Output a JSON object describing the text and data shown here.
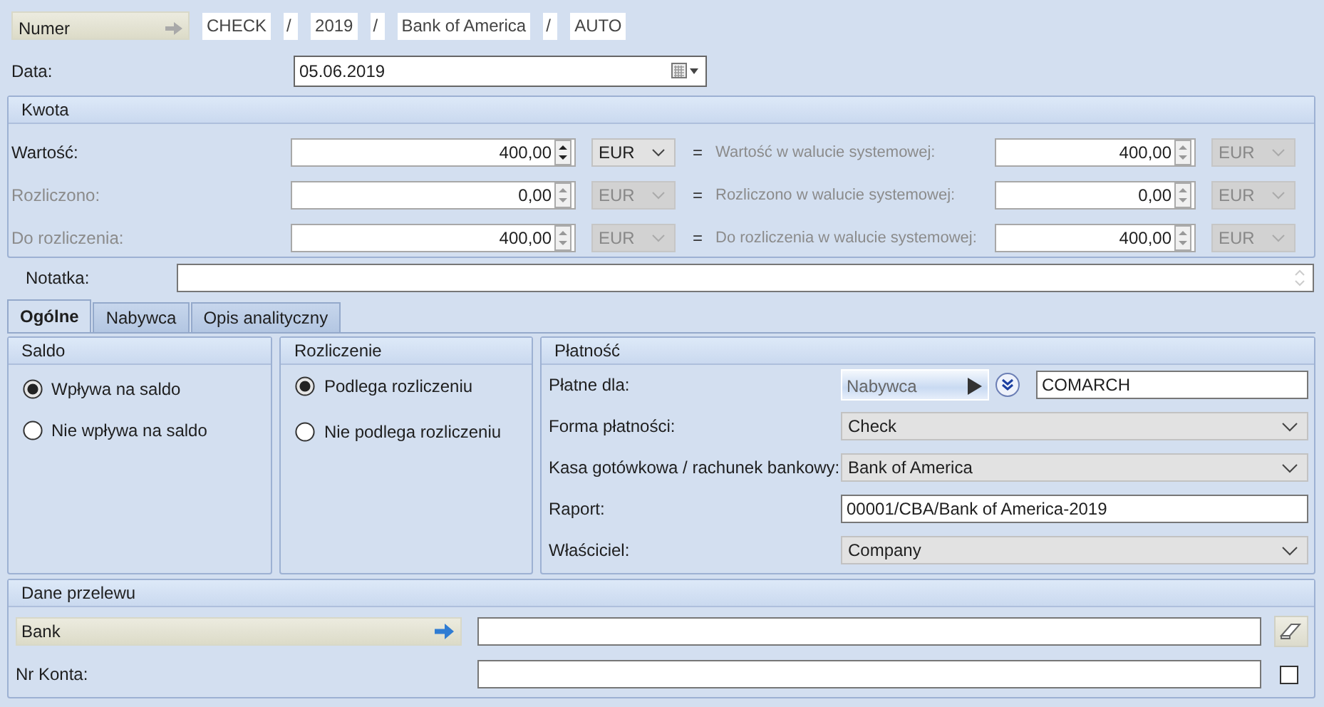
{
  "numer": {
    "label": "Numer",
    "segments": [
      {
        "kind": "field",
        "text": "CHECK"
      },
      {
        "kind": "sep",
        "text": "/"
      },
      {
        "kind": "field",
        "text": "2019"
      },
      {
        "kind": "sep",
        "text": "/"
      },
      {
        "kind": "field",
        "text": "Bank of America"
      },
      {
        "kind": "sep",
        "text": "/"
      },
      {
        "kind": "field",
        "text": "AUTO"
      }
    ]
  },
  "data": {
    "label": "Data:",
    "value": "05.06.2019"
  },
  "kwota": {
    "title": "Kwota",
    "rows": [
      {
        "label": "Wartość:",
        "disabled": false,
        "value": "400,00",
        "currency": "EUR",
        "equals": "=",
        "system_label": "Wartość w walucie systemowej:",
        "system_value": "400,00",
        "system_currency": "EUR",
        "system_disabled": true
      },
      {
        "label": "Rozliczono:",
        "disabled": true,
        "value": "0,00",
        "currency": "EUR",
        "equals": "=",
        "system_label": "Rozliczono w walucie systemowej:",
        "system_value": "0,00",
        "system_currency": "EUR",
        "system_disabled": true
      },
      {
        "label": "Do rozliczenia:",
        "disabled": true,
        "value": "400,00",
        "currency": "EUR",
        "equals": "=",
        "system_label": "Do rozliczenia w walucie systemowej:",
        "system_value": "400,00",
        "system_currency": "EUR",
        "system_disabled": true
      }
    ]
  },
  "notatka": {
    "label": "Notatka:"
  },
  "tabs": [
    {
      "label": "Ogólne",
      "selected": true
    },
    {
      "label": "Nabywca",
      "selected": false
    },
    {
      "label": "Opis analityczny",
      "selected": false
    }
  ],
  "radio_groups": [
    {
      "title": "Saldo",
      "options": [
        {
          "label": "Wpływa na saldo",
          "selected": true
        },
        {
          "label": "Nie wpływa na saldo",
          "selected": false
        }
      ]
    },
    {
      "title": "Rozliczenie",
      "options": [
        {
          "label": "Podlega rozliczeniu",
          "selected": true
        },
        {
          "label": "Nie podlega rozliczeniu",
          "selected": false
        }
      ]
    }
  ],
  "platnosc": {
    "title": "Płatność",
    "rows": [
      {
        "kind": "party",
        "label": "Płatne dla:",
        "button": "Nabywca",
        "value": "COMARCH"
      },
      {
        "kind": "select",
        "label": "Forma płatności:",
        "value": "Check"
      },
      {
        "kind": "select",
        "label": "Kasa gotówkowa / rachunek bankowy:",
        "value": "Bank of America"
      },
      {
        "kind": "text",
        "label": "Raport:",
        "value": "00001/CBA/Bank of America-2019"
      },
      {
        "kind": "select",
        "label": "Właściciel:",
        "value": "Company"
      }
    ]
  },
  "dane_przelewu": {
    "title": "Dane przelewu",
    "bank_button": "Bank",
    "account_label": "Nr Konta:",
    "account_checked": false
  }
}
